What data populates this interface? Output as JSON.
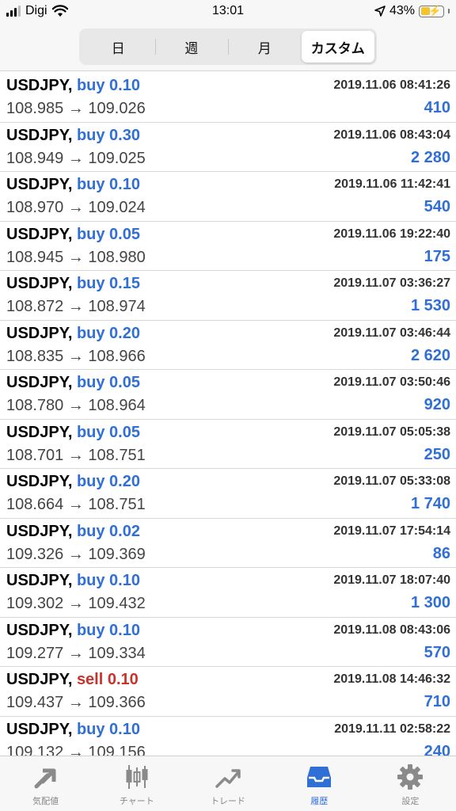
{
  "status_bar": {
    "carrier": "Digi",
    "time": "13:01",
    "battery_percent": "43%",
    "battery_level": 0.43
  },
  "segmented_control": {
    "options": [
      "日",
      "週",
      "月",
      "カスタム"
    ],
    "selected_index": 3
  },
  "colors": {
    "buy": "#2f6fd6",
    "sell": "#c8332b",
    "profit": "#2f6fd6",
    "active_tab": "#2f6fd6",
    "inactive_tab": "#888888"
  },
  "trades": [
    {
      "symbol": "USDJPY,",
      "side": "buy 0.10",
      "type": "buy",
      "time": "2019.11.06 08:41:26",
      "price": "108.985 → 109.026",
      "profit": "410"
    },
    {
      "symbol": "USDJPY,",
      "side": "buy 0.30",
      "type": "buy",
      "time": "2019.11.06 08:43:04",
      "price": "108.949 → 109.025",
      "profit": "2 280"
    },
    {
      "symbol": "USDJPY,",
      "side": "buy 0.10",
      "type": "buy",
      "time": "2019.11.06 11:42:41",
      "price": "108.970 → 109.024",
      "profit": "540"
    },
    {
      "symbol": "USDJPY,",
      "side": "buy 0.05",
      "type": "buy",
      "time": "2019.11.06 19:22:40",
      "price": "108.945 → 108.980",
      "profit": "175"
    },
    {
      "symbol": "USDJPY,",
      "side": "buy 0.15",
      "type": "buy",
      "time": "2019.11.07 03:36:27",
      "price": "108.872 → 108.974",
      "profit": "1 530"
    },
    {
      "symbol": "USDJPY,",
      "side": "buy 0.20",
      "type": "buy",
      "time": "2019.11.07 03:46:44",
      "price": "108.835 → 108.966",
      "profit": "2 620"
    },
    {
      "symbol": "USDJPY,",
      "side": "buy 0.05",
      "type": "buy",
      "time": "2019.11.07 03:50:46",
      "price": "108.780 → 108.964",
      "profit": "920"
    },
    {
      "symbol": "USDJPY,",
      "side": "buy 0.05",
      "type": "buy",
      "time": "2019.11.07 05:05:38",
      "price": "108.701 → 108.751",
      "profit": "250"
    },
    {
      "symbol": "USDJPY,",
      "side": "buy 0.20",
      "type": "buy",
      "time": "2019.11.07 05:33:08",
      "price": "108.664 → 108.751",
      "profit": "1 740"
    },
    {
      "symbol": "USDJPY,",
      "side": "buy 0.02",
      "type": "buy",
      "time": "2019.11.07 17:54:14",
      "price": "109.326 → 109.369",
      "profit": "86"
    },
    {
      "symbol": "USDJPY,",
      "side": "buy 0.10",
      "type": "buy",
      "time": "2019.11.07 18:07:40",
      "price": "109.302 → 109.432",
      "profit": "1 300"
    },
    {
      "symbol": "USDJPY,",
      "side": "buy 0.10",
      "type": "buy",
      "time": "2019.11.08 08:43:06",
      "price": "109.277 → 109.334",
      "profit": "570"
    },
    {
      "symbol": "USDJPY,",
      "side": "sell 0.10",
      "type": "sell",
      "time": "2019.11.08 14:46:32",
      "price": "109.437 → 109.366",
      "profit": "710"
    },
    {
      "symbol": "USDJPY,",
      "side": "buy 0.10",
      "type": "buy",
      "time": "2019.11.11 02:58:22",
      "price": "109.132 → 109.156",
      "profit": "240"
    }
  ],
  "tab_bar": {
    "tabs": [
      {
        "label": "気配値",
        "icon": "quotes-arrows-icon"
      },
      {
        "label": "チャート",
        "icon": "candlestick-chart-icon"
      },
      {
        "label": "トレード",
        "icon": "trade-trend-icon"
      },
      {
        "label": "履歴",
        "icon": "history-inbox-icon"
      },
      {
        "label": "設定",
        "icon": "gear-icon"
      }
    ],
    "active_index": 3
  }
}
